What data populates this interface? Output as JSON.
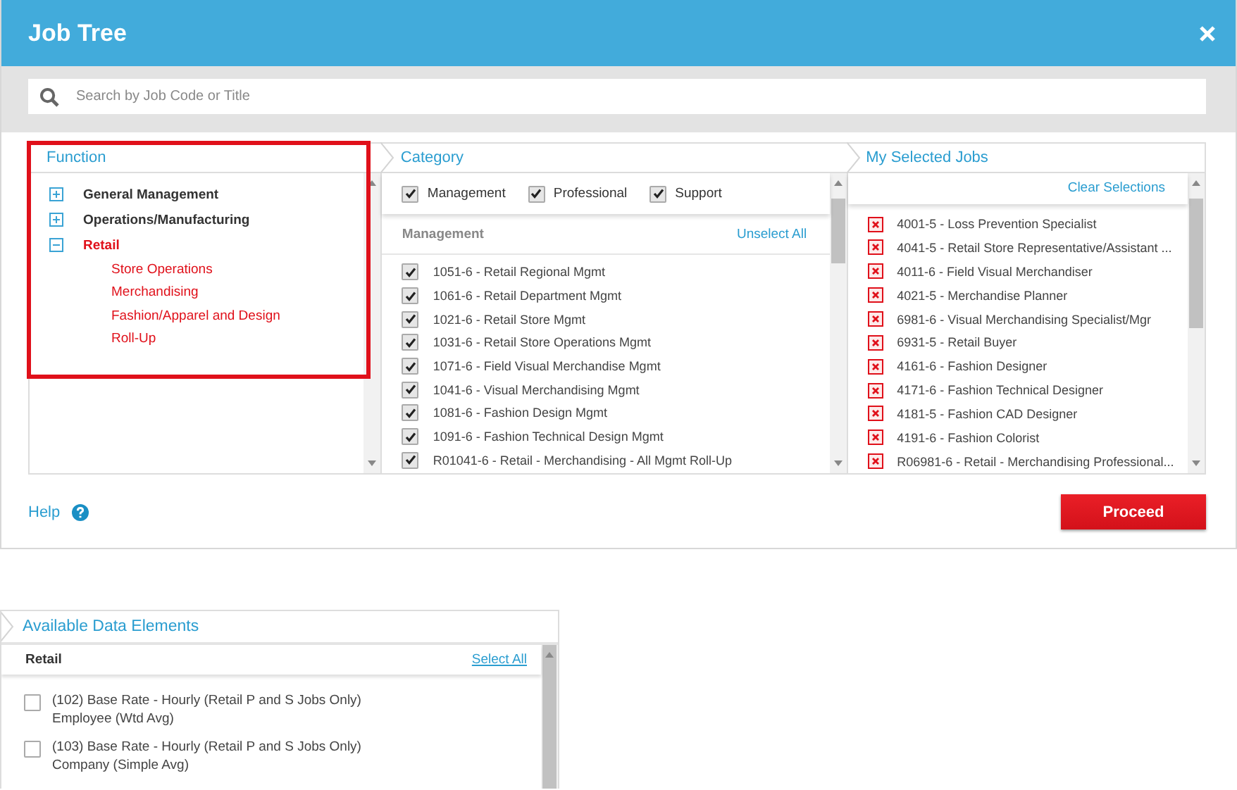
{
  "window": {
    "title": "Job Tree"
  },
  "search": {
    "placeholder": "Search by Job Code or Title"
  },
  "function_panel": {
    "title": "Function",
    "highlighted": true,
    "items": [
      {
        "label": "General Management",
        "expanded": false,
        "selected": false
      },
      {
        "label": "Operations/Manufacturing",
        "expanded": false,
        "selected": false
      },
      {
        "label": "Retail",
        "expanded": true,
        "selected": true,
        "children": [
          {
            "label": "Store Operations",
            "selected": true
          },
          {
            "label": "Merchandising",
            "selected": true
          },
          {
            "label": "Fashion/Apparel and Design",
            "selected": true
          },
          {
            "label": "Roll-Up",
            "selected": true
          }
        ]
      }
    ]
  },
  "category_panel": {
    "title": "Category",
    "filters": [
      {
        "label": "Management",
        "checked": true
      },
      {
        "label": "Professional",
        "checked": true
      },
      {
        "label": "Support",
        "checked": true
      }
    ],
    "group": {
      "title": "Management",
      "action": "Unselect All"
    },
    "jobs": [
      {
        "label": "1051-6 - Retail Regional Mgmt",
        "checked": true
      },
      {
        "label": "1061-6 - Retail Department Mgmt",
        "checked": true
      },
      {
        "label": "1021-6 - Retail Store Mgmt",
        "checked": true
      },
      {
        "label": "1031-6 - Retail Store Operations Mgmt",
        "checked": true
      },
      {
        "label": "1071-6 - Field Visual Merchandise Mgmt",
        "checked": true
      },
      {
        "label": "1041-6 - Visual Merchandising Mgmt",
        "checked": true
      },
      {
        "label": "1081-6 - Fashion Design Mgmt",
        "checked": true
      },
      {
        "label": "1091-6 - Fashion Technical Design Mgmt",
        "checked": true
      },
      {
        "label": "R01041-6 - Retail - Merchandising - All Mgmt Roll-Up",
        "checked": true
      }
    ]
  },
  "selected_panel": {
    "title": "My Selected Jobs",
    "action": "Clear Selections",
    "jobs": [
      "4001-5 - Loss Prevention Specialist",
      "4041-5 - Retail Store Representative/Assistant ...",
      "4011-6 - Field Visual Merchandiser",
      "4021-5 - Merchandise Planner",
      "6981-6 - Visual Merchandising Specialist/Mgr",
      "6931-5 - Retail Buyer",
      "4161-6 - Fashion Designer",
      "4171-6 - Fashion Technical Designer",
      "4181-5 - Fashion CAD Designer",
      "4191-6 - Fashion Colorist",
      "R06981-6 - Retail - Merchandising Professional..."
    ]
  },
  "footer": {
    "help": "Help",
    "button": "Proceed"
  },
  "data_elements": {
    "title": "Available Data Elements",
    "group": "Retail",
    "action": "Select All",
    "items": [
      {
        "label": "(102) Base Rate - Hourly (Retail P and S Jobs Only) Employee (Wtd Avg)",
        "checked": false
      },
      {
        "label": "(103) Base Rate - Hourly (Retail P and S Jobs Only) Company (Simple Avg)",
        "checked": false
      }
    ]
  }
}
